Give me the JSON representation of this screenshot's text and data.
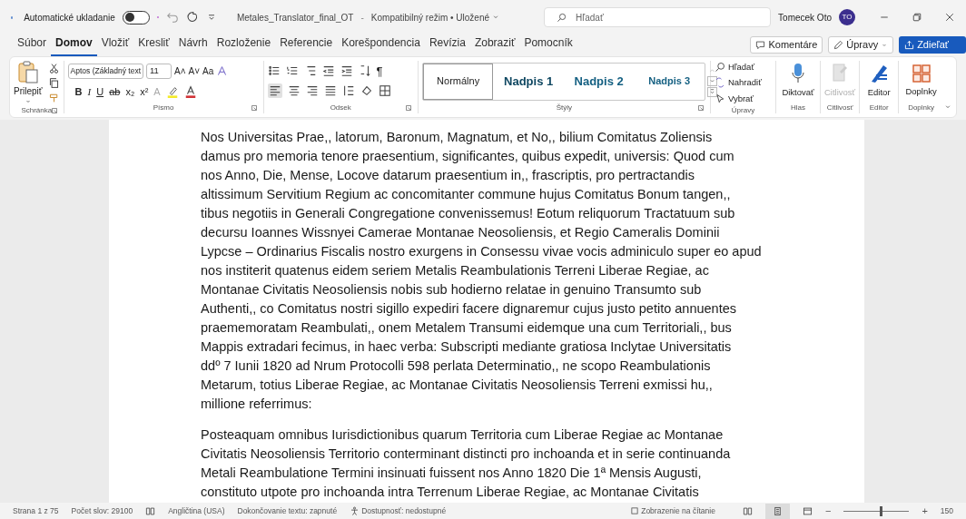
{
  "titlebar": {
    "autosave_label": "Automatické ukladanie",
    "autosave_on": false,
    "doc_name": "Metales_Translator_final_OT",
    "separator": "-",
    "doc_state": "Kompatibilný režim • Uložené",
    "search": {
      "placeholder": "Hľadať"
    },
    "user": "Tomecek Oto",
    "avatar": "TO"
  },
  "tabs": [
    {
      "label": "Súbor",
      "selected": false
    },
    {
      "label": "Domov",
      "selected": true
    },
    {
      "label": "Vložiť",
      "selected": false
    },
    {
      "label": "Kresliť",
      "selected": false
    },
    {
      "label": "Návrh",
      "selected": false
    },
    {
      "label": "Rozloženie",
      "selected": false
    },
    {
      "label": "Referencie",
      "selected": false
    },
    {
      "label": "Korešpondencia",
      "selected": false
    },
    {
      "label": "Revízia",
      "selected": false
    },
    {
      "label": "Zobraziť",
      "selected": false
    },
    {
      "label": "Pomocník",
      "selected": false
    }
  ],
  "actions": {
    "comments": "Komentáre",
    "editing": "Úpravy",
    "share": "Zdieľať"
  },
  "ribbon": {
    "clipboard": {
      "paste": "Prilepiť",
      "label": "Schránka"
    },
    "font": {
      "name": "Aptos (Základný text",
      "size": "11",
      "row1": [
        "A˄",
        "A˅",
        "Aa"
      ],
      "row2": [
        "B",
        "I",
        "U",
        "ab",
        "x₂",
        "x²",
        "A"
      ],
      "label": "Písmo"
    },
    "paragraph": {
      "pilcrow": "¶",
      "label": "Odsek"
    },
    "styles": {
      "items": [
        {
          "label": "Normálny",
          "kind": "normal",
          "selected": true
        },
        {
          "label": "Nadpis 1",
          "kind": "h1",
          "selected": false
        },
        {
          "label": "Nadpis 2",
          "kind": "h2",
          "selected": false
        },
        {
          "label": "Nadpis 3",
          "kind": "h3",
          "selected": false
        }
      ],
      "label": "Štýly"
    },
    "editing": {
      "items": [
        "Hľadať",
        "Nahradiť",
        "Vybrať"
      ],
      "label": "Úpravy"
    },
    "voice": {
      "button": "Diktovať",
      "label": "Hlas"
    },
    "sensitivity": {
      "button": "Citlivosť",
      "disabled": true,
      "label": "Citlivosť"
    },
    "editor": {
      "button": "Editor",
      "label": "Editor"
    },
    "addins": {
      "button": "Doplnky",
      "label": "Doplnky"
    }
  },
  "document": {
    "paragraphs": [
      [
        "Nos Universitas Prae,, latorum, Baronum, Magnatum, et No,, bilium Comitatus Zoliensis",
        "damus pro memoria tenore  praesentium, significantes, quibus expedit, universis: Quod cum",
        "nos Anno, Die, Mense, Locove datarum praesentium in,, frascriptis, pro pertractandis",
        "altissimum Servitium Regium ac concomitanter commune hujus Comitatus Bonum tangen,,",
        "tibus negotiis in Generali Congregatione convenissemus! Eotum reliquorum Tractatuum sub",
        "decursu Ioannes Wissnyei Camerae Montanae Neosoliensis, et Regio Cameralis Dominii",
        "Lypcse – Ordinarius Fiscalis nostro exurgens in Consessu vivae vocis adminiculo super eo apud",
        "nos institerit quatenus eidem seriem Metalis Reambulationis Terreni Liberae Regiae, ac",
        "Montanae Civitatis Neosoliensis nobis sub hodierno relatae in genuino Transumto sub",
        "Authenti,, co Comitatus nostri sigillo expediri facere dignaremur cujus justo petito annuentes",
        "praememoratam Reambulati,, onem Metalem Transumi eidemque una cum Territoriali,, bus",
        "Mappis extradari fecimus, in haec verba: Subscripti mediante gratiosa Inclytae Universitatis",
        "ddº 7 Iunii 1820 ad Nrum Protocolli 598 perlata Determinatio,, ne scopo Reambulationis",
        "Metarum, totius Liberae Regiae, ac Montanae Civitatis Neosoliensis Terreni exmissi hu,,",
        "millione referrimus:"
      ],
      [
        "Posteaquam omnibus Iurisdictionibus quarum Territoria cum Liberae Regiae ac Montanae",
        "Civitatis Neosoliensis Territorio conterminant distincti pro inchoanda et in serie continuanda",
        "Metali Reambulatione Termini insinuati fuissent nos Anno 1820 Die 1ª Mensis Augusti,",
        "constituto utpote pro inchoanda intra Terrenum Liberae Regiae, ac Montanae Civitatis"
      ]
    ]
  },
  "status_bar": {
    "page": "Strana 1 z 75",
    "words": "Počet slov: 29100",
    "language": "Angličtina (USA)",
    "predictions": "Dokončovanie textu: zapnuté",
    "accessibility": "Dostupnosť: nedostupné",
    "focus": "Zobrazenie na čítanie",
    "zoom_out": "−",
    "zoom": {
      "level": 0.55
    },
    "zoom_in": "+",
    "zoom_text": "150"
  }
}
